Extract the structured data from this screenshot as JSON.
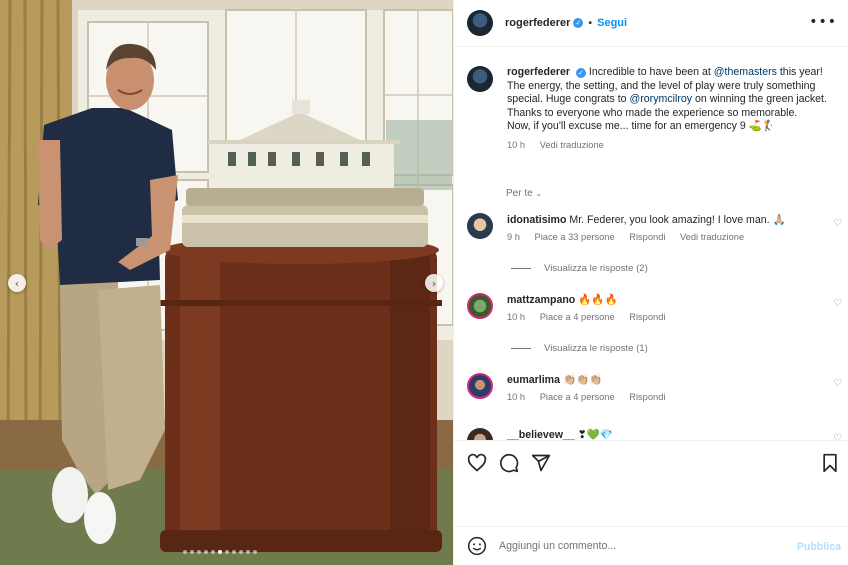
{
  "post": {
    "username": "rogerfederer",
    "follow_label": "Segui",
    "more_label": "•••",
    "caption_parts": {
      "p1": "Incredible to have been at ",
      "m1": "@themasters",
      "p2": " this year! The energy, the setting, and the level of play were truly something special. Huge congrats to ",
      "m2": "@rorymcilroy",
      "p3": " on winning the green jacket. Thanks to everyone who made the experience so memorable.",
      "p4": "Now, if you'll excuse me... time for an emergency 9 ⛳🏌"
    },
    "caption_time": "10 h",
    "caption_translate": "Vedi traduzione",
    "sort_label": "Per te",
    "carousel": {
      "slide_count": 11,
      "active_index": 5
    }
  },
  "comments": [
    {
      "username": "idonatisimo",
      "text": "Mr. Federer, you look amazing! I love man. 🙏🏼",
      "time": "9 h",
      "likes": "Piace a 33 persone",
      "reply": "Rispondi",
      "translate": "Vedi traduzione",
      "replies_label": "Visualizza le risposte (2)"
    },
    {
      "username": "mattzampano",
      "text": "🔥🔥🔥",
      "time": "10 h",
      "likes": "Piace a 4 persone",
      "reply": "Rispondi",
      "replies_label": "Visualizza le risposte (1)"
    },
    {
      "username": "eumarlima",
      "text": "👏🏼👏🏼👏🏼",
      "time": "10 h",
      "likes": "Piace a 4 persone",
      "reply": "Rispondi"
    },
    {
      "username": "__believew__",
      "text": "❣💚💎"
    }
  ],
  "composer": {
    "placeholder": "Aggiungi un commento...",
    "publish_label": "Pubblica"
  },
  "colors": {
    "link": "#0095f6",
    "mention": "#00376b",
    "muted": "#737373",
    "verified": "#3897f0"
  },
  "icons": [
    "heart-icon",
    "comment-icon",
    "share-icon",
    "bookmark-icon",
    "emoji-icon",
    "verified-icon",
    "chevron-left-icon",
    "chevron-right-icon",
    "more-icon"
  ]
}
